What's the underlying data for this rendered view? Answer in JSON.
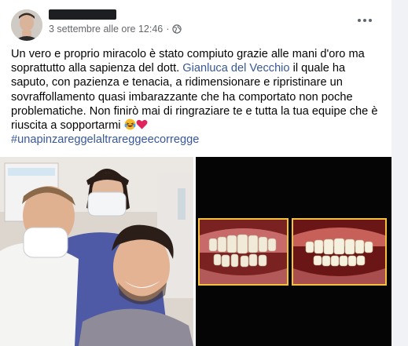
{
  "post": {
    "author_name": "████████",
    "date": "3 settembre alle ore 12:46",
    "separator": "·",
    "privacy_icon": "globe-icon",
    "more_icon": "more-options-icon",
    "text_before_link": "Un vero e proprio miracolo è stato compiuto grazie alle mani d'oro ma soprattutto alla sapienza del dott. ",
    "mention": "Gianluca del Vecchio",
    "text_after_link": " il quale ha saputo, con pazienza e tenacia, a ridimensionare e ripristinare un sovraffollamento quasi imbarazzante che ha comportato non poche problematiche. Non finirò mai di ringraziare te e tutta la tua equipe che è riuscita a sopportarmi ",
    "emojis": [
      "laughing-crying-emoji",
      "red-heart-emoji"
    ],
    "hashtag": "#unapinzareggelaltrareggeecorregge"
  },
  "colors": {
    "link": "#385898",
    "text": "#050505",
    "meta": "#65676b",
    "frame": "#f4c13a"
  }
}
